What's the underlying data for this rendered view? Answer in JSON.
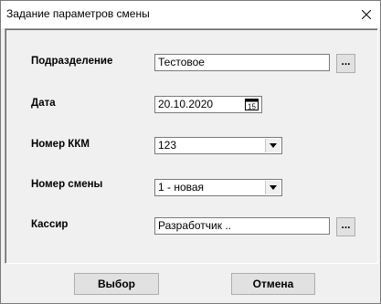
{
  "window": {
    "title": "Задание параметров смены"
  },
  "form": {
    "division": {
      "label": "Подразделение",
      "value": "Тестовое",
      "browse_label": "..."
    },
    "date": {
      "label": "Дата",
      "value": "20.10.2020",
      "calendar_icon_text": "15"
    },
    "kkm": {
      "label": "Номер ККМ",
      "value": "123"
    },
    "shift": {
      "label": "Номер смены",
      "value": "1  - новая"
    },
    "cashier": {
      "label": "Кассир",
      "value": "Разработчик ..",
      "browse_label": "..."
    }
  },
  "buttons": {
    "select_label": "Выбор",
    "cancel_label": "Отмена"
  },
  "icons": {
    "close": "close-icon",
    "combo": "chevron-down-icon",
    "calendar": "calendar-icon"
  }
}
